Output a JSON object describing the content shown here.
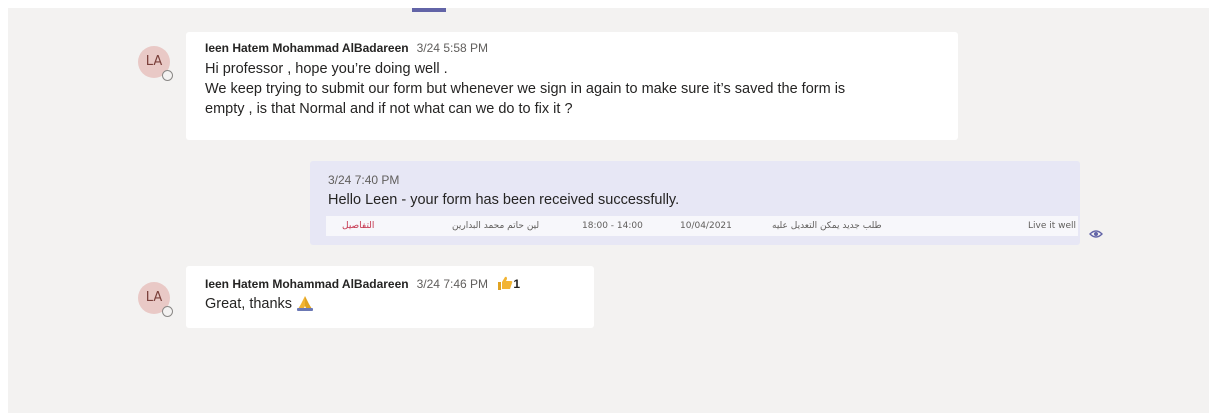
{
  "messages": [
    {
      "avatar_initials": "LA",
      "sender": "Ieen Hatem Mohammad AlBadareen",
      "time": "3/24 5:58 PM",
      "lines": [
        "Hi professor  , hope you’re doing well .",
        "We keep trying to submit our form but whenever we sign in again to make sure it’s saved the form is",
        "empty , is that Normal and if not what can we do to fix it ?"
      ]
    },
    {
      "time": "3/24 7:40 PM",
      "text": "Hello Leen - your form has been received successfully.",
      "attachment": {
        "status": "التفاصيل",
        "name": "لين حاتم محمد البدارين",
        "hours": "18:00 - 14:00",
        "date": "10/04/2021",
        "request": "طلب جديد يمكن التعديل عليه",
        "note": "Live it well"
      }
    },
    {
      "avatar_initials": "LA",
      "sender": "Ieen Hatem Mohammad AlBadareen",
      "time": "3/24 7:46 PM",
      "reaction_count": "1",
      "text": "Great, thanks"
    }
  ],
  "icons": {
    "read_receipt": "eye-icon",
    "reaction": "thumbs-up-icon",
    "emoji": "folded-hands-icon"
  },
  "colors": {
    "accent": "#6264a7",
    "own_bubble": "#e7e7f5",
    "status_red": "#c4314b",
    "like_yellow": "#f2b433"
  }
}
